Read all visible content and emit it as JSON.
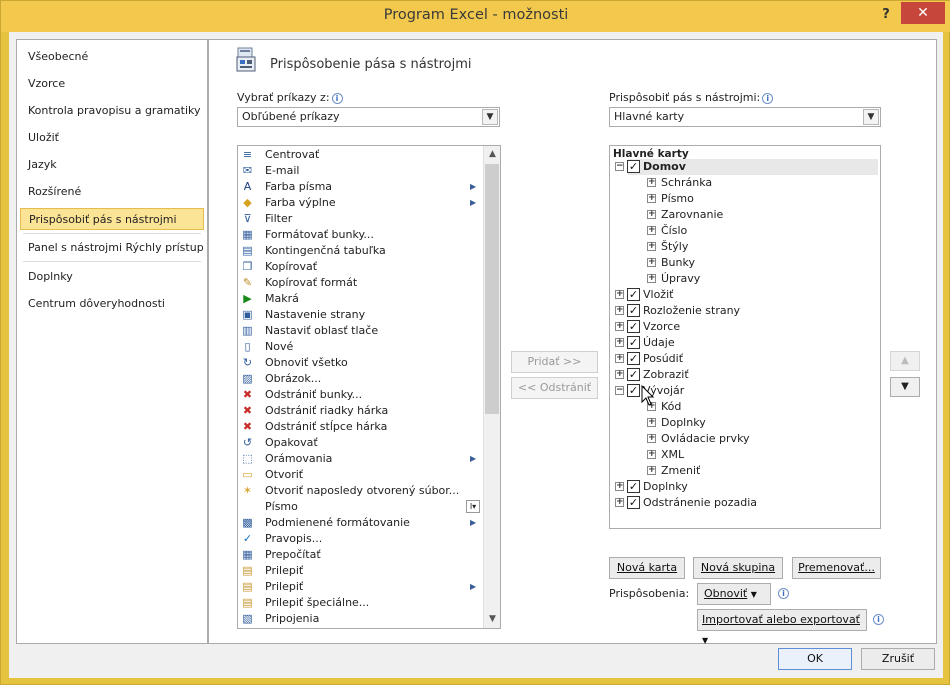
{
  "window": {
    "title": "Program Excel - možnosti",
    "help": "?",
    "close": "✕"
  },
  "nav": {
    "items": [
      "Všeobecné",
      "Vzorce",
      "Kontrola pravopisu a gramatiky",
      "Uložiť",
      "Jazyk",
      "Rozšírené",
      "Prispôsobiť pás s nástrojmi",
      "Panel s nástrojmi Rýchly prístup",
      "Doplnky",
      "Centrum dôveryhodnosti"
    ],
    "selected": "Prispôsobiť pás s nástrojmi"
  },
  "header": {
    "title": "Prispôsobenie pása s nástrojmi"
  },
  "left": {
    "label": "Vybrať príkazy z:",
    "combo_value": "Obľúbené príkazy",
    "commands": [
      {
        "label": "Centrovať",
        "icon": "center-icon",
        "sub": false
      },
      {
        "label": "E-mail",
        "icon": "email-icon",
        "sub": false
      },
      {
        "label": "Farba písma",
        "icon": "font-color-icon",
        "sub": true
      },
      {
        "label": "Farba výplne",
        "icon": "fill-color-icon",
        "sub": true
      },
      {
        "label": "Filter",
        "icon": "filter-icon",
        "sub": false
      },
      {
        "label": "Formátovať bunky...",
        "icon": "format-cells-icon",
        "sub": false
      },
      {
        "label": "Kontingenčná tabuľka",
        "icon": "pivot-table-icon",
        "sub": false
      },
      {
        "label": "Kopírovať",
        "icon": "copy-icon",
        "sub": false
      },
      {
        "label": "Kopírovať formát",
        "icon": "format-painter-icon",
        "sub": false
      },
      {
        "label": "Makrá",
        "icon": "macro-icon",
        "sub": false
      },
      {
        "label": "Nastavenie strany",
        "icon": "page-setup-icon",
        "sub": false
      },
      {
        "label": "Nastaviť oblasť tlače",
        "icon": "print-area-icon",
        "sub": false
      },
      {
        "label": "Nové",
        "icon": "new-file-icon",
        "sub": false
      },
      {
        "label": "Obnoviť všetko",
        "icon": "refresh-all-icon",
        "sub": false
      },
      {
        "label": "Obrázok...",
        "icon": "picture-icon",
        "sub": false
      },
      {
        "label": "Odstrániť bunky...",
        "icon": "delete-cells-icon",
        "sub": false
      },
      {
        "label": "Odstrániť riadky hárka",
        "icon": "delete-rows-icon",
        "sub": false
      },
      {
        "label": "Odstrániť stĺpce hárka",
        "icon": "delete-columns-icon",
        "sub": false
      },
      {
        "label": "Opakovať",
        "icon": "repeat-icon",
        "sub": false
      },
      {
        "label": "Orámovania",
        "icon": "borders-icon",
        "sub": true
      },
      {
        "label": "Otvoriť",
        "icon": "open-folder-icon",
        "sub": false
      },
      {
        "label": "Otvoriť naposledy otvorený súbor...",
        "icon": "open-recent-icon",
        "sub": false
      },
      {
        "label": "Písmo",
        "icon": "font-icon",
        "sub": false
      },
      {
        "label": "Podmienené formátovanie",
        "icon": "conditional-format-icon",
        "sub": true
      },
      {
        "label": "Pravopis...",
        "icon": "spelling-icon",
        "sub": false
      },
      {
        "label": "Prepočítať",
        "icon": "calculate-icon",
        "sub": false
      },
      {
        "label": "Prilepiť",
        "icon": "paste-icon",
        "sub": false
      },
      {
        "label": "Prilepiť",
        "icon": "paste-icon",
        "sub": true
      },
      {
        "label": "Prilepiť špeciálne...",
        "icon": "paste-special-icon",
        "sub": false
      },
      {
        "label": "Pripojenia",
        "icon": "connections-icon",
        "sub": false
      }
    ]
  },
  "right": {
    "label": "Prispôsobiť pás s nástrojmi:",
    "combo_value": "Hlavné karty",
    "tree_header": "Hlavné karty",
    "tree": [
      {
        "label": "Domov",
        "level": 0,
        "expander": "minus",
        "checked": true,
        "selected": true
      },
      {
        "label": "Schránka",
        "level": 1,
        "expander": "plus"
      },
      {
        "label": "Písmo",
        "level": 1,
        "expander": "plus"
      },
      {
        "label": "Zarovnanie",
        "level": 1,
        "expander": "plus"
      },
      {
        "label": "Číslo",
        "level": 1,
        "expander": "plus"
      },
      {
        "label": "Štýly",
        "level": 1,
        "expander": "plus"
      },
      {
        "label": "Bunky",
        "level": 1,
        "expander": "plus"
      },
      {
        "label": "Úpravy",
        "level": 1,
        "expander": "plus"
      },
      {
        "label": "Vložiť",
        "level": 0,
        "expander": "plus",
        "checked": true
      },
      {
        "label": "Rozloženie strany",
        "level": 0,
        "expander": "plus",
        "checked": true
      },
      {
        "label": "Vzorce",
        "level": 0,
        "expander": "plus",
        "checked": true
      },
      {
        "label": "Údaje",
        "level": 0,
        "expander": "plus",
        "checked": true
      },
      {
        "label": "Posúdiť",
        "level": 0,
        "expander": "plus",
        "checked": true
      },
      {
        "label": "Zobraziť",
        "level": 0,
        "expander": "plus",
        "checked": true
      },
      {
        "label": "Vývojár",
        "level": 0,
        "expander": "minus",
        "checked": true
      },
      {
        "label": "Kód",
        "level": 1,
        "expander": "plus"
      },
      {
        "label": "Doplnky",
        "level": 1,
        "expander": "plus"
      },
      {
        "label": "Ovládacie prvky",
        "level": 1,
        "expander": "plus"
      },
      {
        "label": "XML",
        "level": 1,
        "expander": "plus"
      },
      {
        "label": "Zmeniť",
        "level": 1,
        "expander": "plus"
      },
      {
        "label": "Doplnky",
        "level": 0,
        "expander": "plus",
        "checked": true
      },
      {
        "label": "Odstránenie pozadia",
        "level": 0,
        "expander": "plus",
        "checked": true
      }
    ],
    "new_tab": "Nová karta",
    "new_group": "Nová skupina",
    "rename": "Premenovať...",
    "customizations_label": "Prispôsobenia:",
    "reset": "Obnoviť",
    "import_export": "Importovať alebo exportovať"
  },
  "middle": {
    "add": "Pridať >>",
    "remove": "<< Odstrániť"
  },
  "footer": {
    "ok": "OK",
    "cancel": "Zrušiť"
  },
  "colors": {
    "title_bar": "#f2c94c",
    "close": "#c7463c",
    "nav_selected": "#fbe496"
  }
}
